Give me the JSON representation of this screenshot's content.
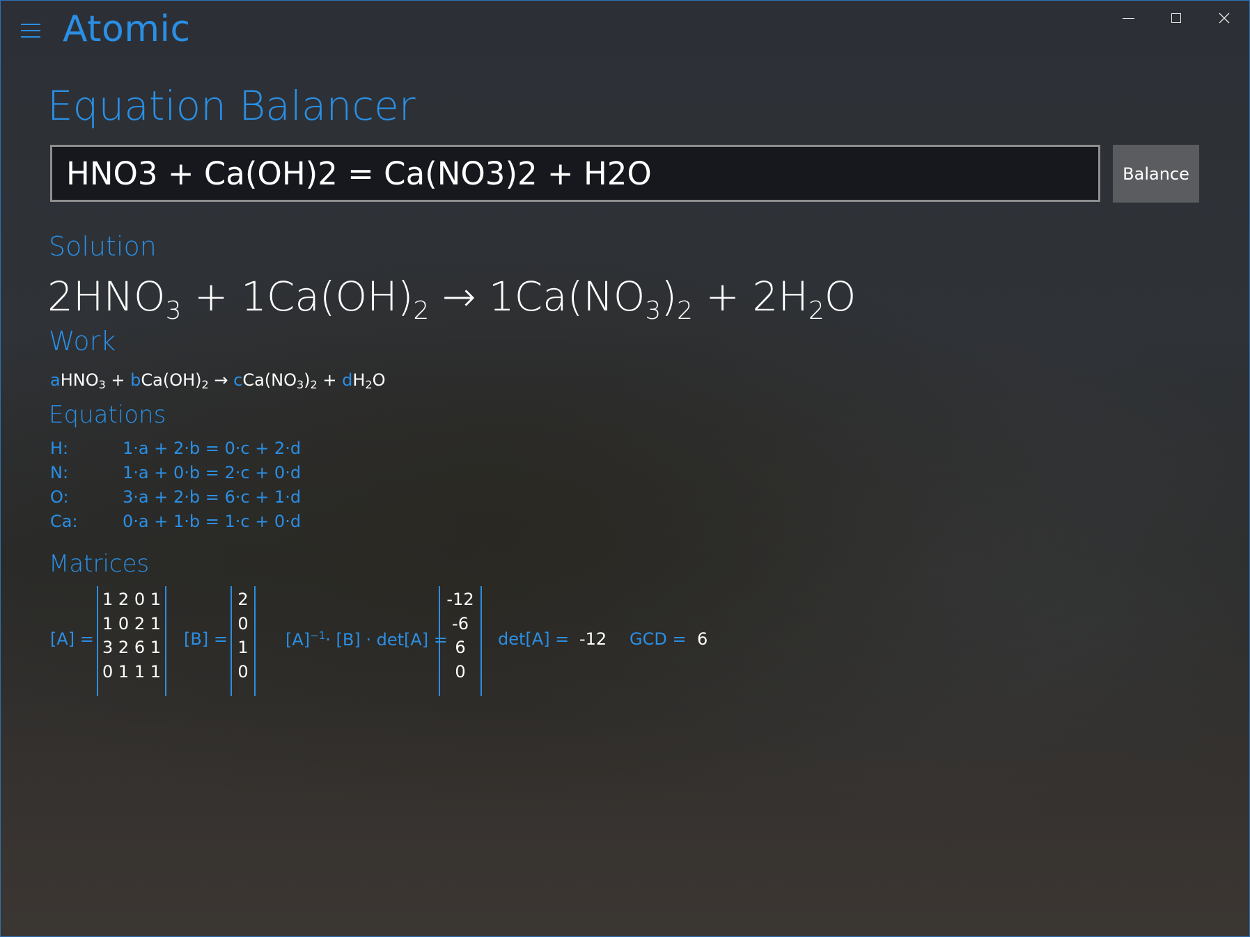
{
  "app": {
    "title": "Atomic"
  },
  "window_controls": {
    "minimize": "minimize-icon",
    "maximize": "maximize-icon",
    "close": "close-icon"
  },
  "page": {
    "heading": "Equation Balancer",
    "input_value": "HNO3 + Ca(OH)2 = Ca(NO3)2 + H2O",
    "balance_label": "Balance"
  },
  "solution": {
    "label": "Solution"
  },
  "work": {
    "label": "Work"
  },
  "equations": {
    "label": "Equations",
    "rows": [
      {
        "element": "H:",
        "expr": "1·a + 2·b = 0·c + 2·d"
      },
      {
        "element": "N:",
        "expr": "1·a + 0·b = 2·c + 0·d"
      },
      {
        "element": "O:",
        "expr": "3·a + 2·b = 6·c + 1·d"
      },
      {
        "element": "Ca:",
        "expr": "0·a + 1·b = 1·c + 0·d"
      }
    ]
  },
  "matrices": {
    "label": "Matrices",
    "a_label": "[A] =",
    "a_rows": [
      "1 2 0 1",
      "1 0 2 1",
      "3 2 6 1",
      "0 1 1 1"
    ],
    "b_label": "[B] =",
    "b_rows": [
      "2",
      "0",
      "1",
      "0"
    ],
    "product_label_pre": "[A]",
    "product_label_sup": "−1",
    "product_label_post": "· [B] · det[A] =",
    "product_rows": [
      "-12",
      "-6",
      "6",
      "0"
    ],
    "det_label": "det[A] =",
    "det_value": "-12",
    "gcd_label": "GCD =",
    "gcd_value": "6"
  },
  "colors": {
    "accent": "#2a8fe5",
    "text": "#ffffff",
    "input_bg": "#16181d",
    "button_bg": "#5b5c5f"
  }
}
